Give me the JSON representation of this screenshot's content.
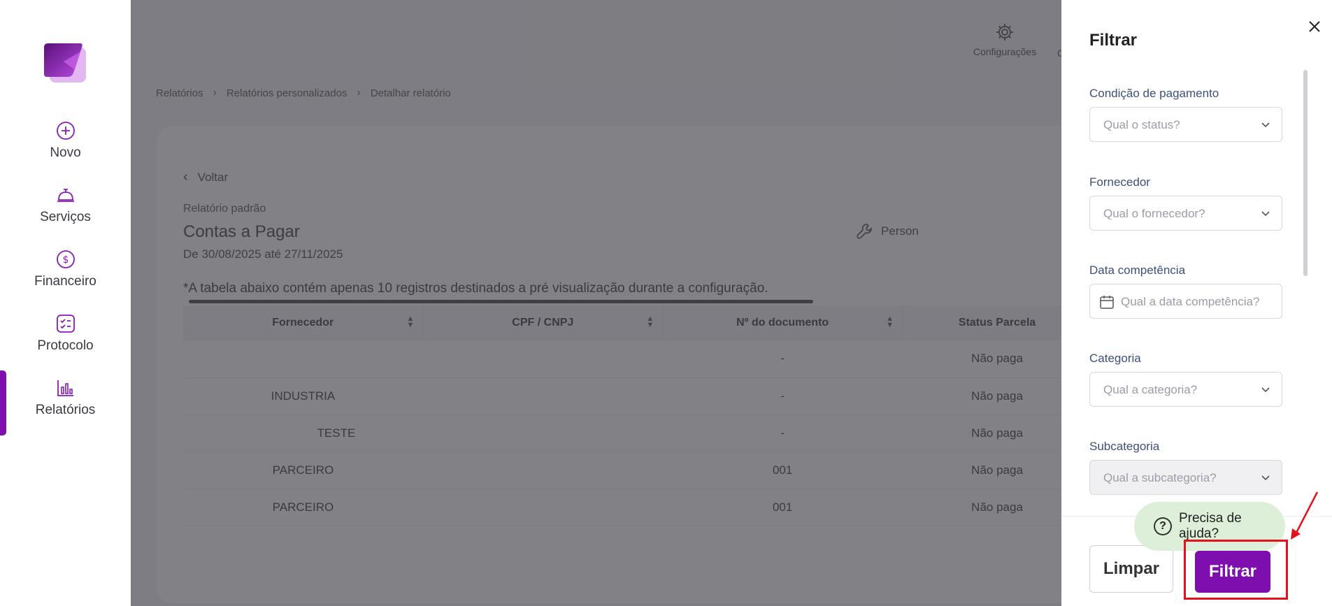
{
  "sidebar": {
    "items": [
      {
        "label": "Novo",
        "icon": "plus-circle-icon"
      },
      {
        "label": "Serviços",
        "icon": "service-bell-icon"
      },
      {
        "label": "Financeiro",
        "icon": "dollar-circle-icon"
      },
      {
        "label": "Protocolo",
        "icon": "checklist-icon"
      },
      {
        "label": "Relatórios",
        "icon": "bar-chart-icon"
      }
    ],
    "active": "Relatórios",
    "accent": "#7e0fae"
  },
  "header": {
    "config_label": "Configurações",
    "config_label_2": "C"
  },
  "breadcrumb": [
    "Relatórios",
    "Relatórios personalizados",
    "Detalhar relatório"
  ],
  "report": {
    "back_label": "Voltar",
    "subtitle": "Relatório padrão",
    "title": "Contas a Pagar",
    "range": "De 30/08/2025 até 27/11/2025",
    "personalize_label": "Person",
    "note": "*A tabela abaixo contém apenas 10 registros destinados a pré visualização durante a configuração."
  },
  "table": {
    "headers": [
      "Fornecedor",
      "CPF / CNPJ",
      "Nº do documento",
      "Status Parcela"
    ],
    "rows": [
      [
        "",
        "",
        "-",
        "Não paga"
      ],
      [
        "INDUSTRIA",
        "",
        "-",
        "Não paga"
      ],
      [
        "TESTE",
        "",
        "-",
        "Não paga"
      ],
      [
        "PARCEIRO",
        "",
        "001",
        "Não paga"
      ],
      [
        "PARCEIRO",
        "",
        "001",
        "Não paga"
      ]
    ]
  },
  "filter": {
    "title": "Filtrar",
    "fields": [
      {
        "label": "Condição de pagamento",
        "placeholder": "Qual o status?"
      },
      {
        "label": "Fornecedor",
        "placeholder": "Qual o fornecedor?"
      },
      {
        "label": "Data competência",
        "placeholder": "Qual a data competência?"
      },
      {
        "label": "Categoria",
        "placeholder": "Qual a categoria?"
      },
      {
        "label": "Subcategoria",
        "placeholder": "Qual a subcategoria?"
      }
    ],
    "clear_label": "Limpar",
    "submit_label": "Filtrar"
  },
  "help": {
    "label": "Precisa de ajuda?",
    "color": "#ddefd9"
  },
  "highlight_color": "#e5101b"
}
